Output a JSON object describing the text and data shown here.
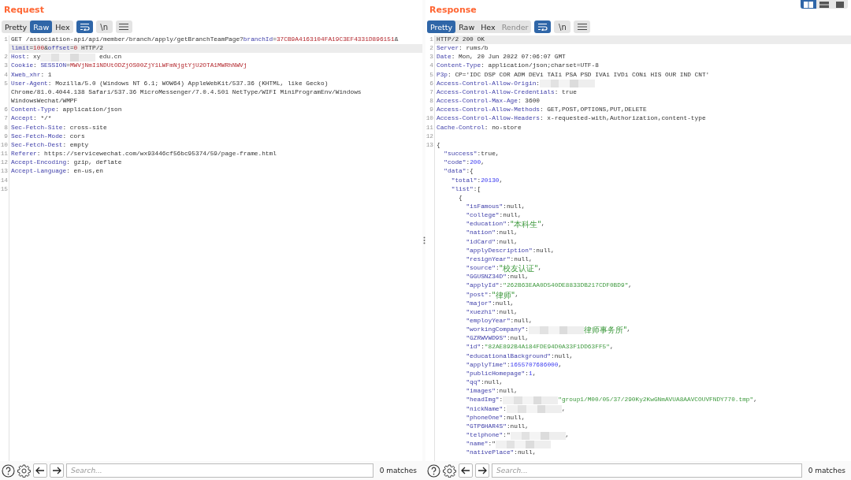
{
  "panes": [
    {
      "title": "Request",
      "tabs": [
        {
          "label": "Pretty",
          "selected": false,
          "disabled": false
        },
        {
          "label": "Raw",
          "selected": true,
          "disabled": false
        },
        {
          "label": "Hex",
          "selected": false,
          "disabled": false
        }
      ],
      "wrap_on": true,
      "newline_label": "\\n",
      "newline_on": false,
      "rows": [
        {
          "number": "1",
          "current": false,
          "segments": [
            {
              "kind": "plain",
              "text": "GET /association-api/api/member/branch/apply/getBranchTeamPage?"
            },
            {
              "kind": "key",
              "text": "branchId"
            },
            {
              "kind": "plain",
              "text": "="
            },
            {
              "kind": "param",
              "text": "37CB9A4163104FA19C3EF4331D896151"
            },
            {
              "kind": "plain",
              "text": "&"
            }
          ]
        },
        {
          "current": true,
          "segments": [
            {
              "kind": "key",
              "text": "limit"
            },
            {
              "kind": "plain",
              "text": "="
            },
            {
              "kind": "param",
              "text": "100"
            },
            {
              "kind": "plain",
              "text": "&"
            },
            {
              "kind": "key",
              "text": "offset"
            },
            {
              "kind": "plain",
              "text": "="
            },
            {
              "kind": "param",
              "text": "0"
            },
            {
              "kind": "plain",
              "text": " HTTP/2"
            }
          ]
        },
        {
          "number": "2",
          "current": false,
          "segments": [
            {
              "kind": "key",
              "text": "Host"
            },
            {
              "kind": "plain",
              "text": ": xy"
            },
            {
              "kind": "redacted"
            },
            {
              "kind": "plain",
              "text": " edu.cn"
            }
          ]
        },
        {
          "number": "3",
          "current": false,
          "segments": [
            {
              "kind": "key",
              "text": "Cookie"
            },
            {
              "kind": "plain",
              "text": ": "
            },
            {
              "kind": "key",
              "text": "SESSION"
            },
            {
              "kind": "plain",
              "text": "="
            },
            {
              "kind": "param",
              "text": "MWVjNmI1NDUtODZjOS00ZjY1LWFmNjgtYjU2OTA1MWRhNWVj"
            }
          ]
        },
        {
          "number": "4",
          "current": false,
          "segments": [
            {
              "kind": "key",
              "text": "Xweb_xhr"
            },
            {
              "kind": "plain",
              "text": ": 1"
            }
          ]
        },
        {
          "number": "5",
          "current": false,
          "segments": [
            {
              "kind": "key",
              "text": "User-Agent"
            },
            {
              "kind": "plain",
              "text": ": Mozilla/5.0 (Windows NT 6.1; WOW64) AppleWebKit/537.36 (KHTML, like Gecko)"
            }
          ]
        },
        {
          "current": false,
          "segments": [
            {
              "kind": "plain",
              "text": "Chrome/81.0.4044.138 Safari/537.36 MicroMessenger/7.0.4.501 NetType/WIFI MiniProgramEnv/Windows"
            }
          ]
        },
        {
          "current": false,
          "segments": [
            {
              "kind": "plain",
              "text": "WindowsWechat/WMPF"
            }
          ]
        },
        {
          "number": "6",
          "current": false,
          "segments": [
            {
              "kind": "key",
              "text": "Content-Type"
            },
            {
              "kind": "plain",
              "text": ": application/json"
            }
          ]
        },
        {
          "number": "7",
          "current": false,
          "segments": [
            {
              "kind": "key",
              "text": "Accept"
            },
            {
              "kind": "plain",
              "text": ": */*"
            }
          ]
        },
        {
          "number": "8",
          "current": false,
          "segments": [
            {
              "kind": "key",
              "text": "Sec-Fetch-Site"
            },
            {
              "kind": "plain",
              "text": ": cross-site"
            }
          ]
        },
        {
          "number": "9",
          "current": false,
          "segments": [
            {
              "kind": "key",
              "text": "Sec-Fetch-Mode"
            },
            {
              "kind": "plain",
              "text": ": cors"
            }
          ]
        },
        {
          "number": "10",
          "current": false,
          "segments": [
            {
              "kind": "key",
              "text": "Sec-Fetch-Dest"
            },
            {
              "kind": "plain",
              "text": ": empty"
            }
          ]
        },
        {
          "number": "11",
          "current": false,
          "segments": [
            {
              "kind": "key",
              "text": "Referer"
            },
            {
              "kind": "plain",
              "text": ": https://servicewechat.com/wx93446cf56bc95374/59/page-frame.html"
            }
          ]
        },
        {
          "number": "12",
          "current": false,
          "segments": [
            {
              "kind": "key",
              "text": "Accept-Encoding"
            },
            {
              "kind": "plain",
              "text": ": gzip, deflate"
            }
          ]
        },
        {
          "number": "13",
          "current": false,
          "segments": [
            {
              "kind": "key",
              "text": "Accept-Language"
            },
            {
              "kind": "plain",
              "text": ": en-us,en"
            }
          ]
        },
        {
          "number": "14",
          "current": false
        },
        {
          "number": "15",
          "current": false
        }
      ],
      "search": {
        "placeholder": "Search...",
        "matches": "0 matches"
      }
    },
    {
      "title": "Response",
      "tabs": [
        {
          "label": "Pretty",
          "selected": true,
          "disabled": false
        },
        {
          "label": "Raw",
          "selected": false,
          "disabled": false
        },
        {
          "label": "Hex",
          "selected": false,
          "disabled": false
        },
        {
          "label": "Render",
          "selected": false,
          "disabled": true
        }
      ],
      "wrap_on": true,
      "newline_label": "\\n",
      "newline_on": false,
      "layout_switch": true,
      "rows": [
        {
          "number": "1",
          "current": true,
          "segments": [
            {
              "kind": "plain",
              "text": "HTTP/2 200 OK"
            }
          ]
        },
        {
          "number": "2",
          "current": false,
          "segments": [
            {
              "kind": "key",
              "text": "Server"
            },
            {
              "kind": "plain",
              "text": ": rums/b"
            }
          ]
        },
        {
          "number": "3",
          "current": false,
          "segments": [
            {
              "kind": "key",
              "text": "Date"
            },
            {
              "kind": "plain",
              "text": ": Mon, 20 Jun 2022 07:06:07 GMT"
            }
          ]
        },
        {
          "number": "4",
          "current": false,
          "segments": [
            {
              "kind": "key",
              "text": "Content-Type"
            },
            {
              "kind": "plain",
              "text": ": application/json;charset=UTF-8"
            }
          ]
        },
        {
          "number": "5",
          "current": false,
          "segments": [
            {
              "kind": "key",
              "text": "P3p"
            },
            {
              "kind": "plain",
              "text": ": CP='IDC DSP COR ADM DEVi TAIi PSA PSD IVAi IVDi CONi HIS OUR IND CNT'"
            }
          ]
        },
        {
          "number": "6",
          "current": false,
          "segments": [
            {
              "kind": "key",
              "text": "Access-Control-Allow-Origin"
            },
            {
              "kind": "plain",
              "text": ":"
            },
            {
              "kind": "redacted"
            }
          ]
        },
        {
          "number": "7",
          "current": false,
          "segments": [
            {
              "kind": "key",
              "text": "Access-Control-Allow-Credentials"
            },
            {
              "kind": "plain",
              "text": ": true"
            }
          ]
        },
        {
          "number": "8",
          "current": false,
          "segments": [
            {
              "kind": "key",
              "text": "Access-Control-Max-Age"
            },
            {
              "kind": "plain",
              "text": ": 3600"
            }
          ]
        },
        {
          "number": "9",
          "current": false,
          "segments": [
            {
              "kind": "key",
              "text": "Access-Control-Allow-Methods"
            },
            {
              "kind": "plain",
              "text": ": GET,POST,OPTIONS,PUT,DELETE"
            }
          ]
        },
        {
          "number": "10",
          "current": false,
          "segments": [
            {
              "kind": "key",
              "text": "Access-Control-Allow-Headers"
            },
            {
              "kind": "plain",
              "text": ": x-requested-with,Authorization,content-type"
            }
          ]
        },
        {
          "number": "11",
          "current": false,
          "segments": [
            {
              "kind": "key",
              "text": "Cache-Control"
            },
            {
              "kind": "plain",
              "text": ": no-store"
            }
          ]
        },
        {
          "number": "12",
          "current": false
        },
        {
          "number": "13",
          "current": false,
          "segments": [
            {
              "kind": "plain",
              "text": "{"
            }
          ]
        },
        {
          "current": false,
          "segments": [
            {
              "kind": "key",
              "text": "  \"success\""
            },
            {
              "kind": "plain",
              "text": ":true,"
            }
          ]
        },
        {
          "current": false,
          "segments": [
            {
              "kind": "key",
              "text": "  \"code\""
            },
            {
              "kind": "plain",
              "text": ":"
            },
            {
              "kind": "num",
              "text": "200"
            },
            {
              "kind": "plain",
              "text": ","
            }
          ]
        },
        {
          "current": false,
          "segments": [
            {
              "kind": "key",
              "text": "  \"data\""
            },
            {
              "kind": "plain",
              "text": ":{"
            }
          ]
        },
        {
          "current": false,
          "segments": [
            {
              "kind": "key",
              "text": "    \"total\""
            },
            {
              "kind": "plain",
              "text": ":"
            },
            {
              "kind": "num",
              "text": "20130"
            },
            {
              "kind": "plain",
              "text": ","
            }
          ]
        },
        {
          "current": false,
          "segments": [
            {
              "kind": "key",
              "text": "    \"list\""
            },
            {
              "kind": "plain",
              "text": ":["
            }
          ]
        },
        {
          "current": false,
          "segments": [
            {
              "kind": "plain",
              "text": "      {"
            }
          ]
        },
        {
          "current": false,
          "segments": [
            {
              "kind": "key",
              "text": "        \"isFamous\""
            },
            {
              "kind": "plain",
              "text": ":null,"
            }
          ]
        },
        {
          "current": false,
          "segments": [
            {
              "kind": "key",
              "text": "        \"college\""
            },
            {
              "kind": "plain",
              "text": ":null,"
            }
          ]
        },
        {
          "current": false,
          "segments": [
            {
              "kind": "key",
              "text": "        \"education\""
            },
            {
              "kind": "plain",
              "text": ":"
            },
            {
              "kind": "str_cjk",
              "text": "\"本科生\""
            },
            {
              "kind": "plain",
              "text": ","
            }
          ]
        },
        {
          "current": false,
          "segments": [
            {
              "kind": "key",
              "text": "        \"nation\""
            },
            {
              "kind": "plain",
              "text": ":null,"
            }
          ]
        },
        {
          "current": false,
          "segments": [
            {
              "kind": "key",
              "text": "        \"idCard\""
            },
            {
              "kind": "plain",
              "text": ":null,"
            }
          ]
        },
        {
          "current": false,
          "segments": [
            {
              "kind": "key",
              "text": "        \"applyDescription\""
            },
            {
              "kind": "plain",
              "text": ":null,"
            }
          ]
        },
        {
          "current": false,
          "segments": [
            {
              "kind": "key",
              "text": "        \"resignYear\""
            },
            {
              "kind": "plain",
              "text": ":null,"
            }
          ]
        },
        {
          "current": false,
          "segments": [
            {
              "kind": "key",
              "text": "        \"source\""
            },
            {
              "kind": "plain",
              "text": ":"
            },
            {
              "kind": "str_cjk",
              "text": "\"校友认证\""
            },
            {
              "kind": "plain",
              "text": ","
            }
          ]
        },
        {
          "current": false,
          "segments": [
            {
              "kind": "key",
              "text": "        \"GGUSNZ34D\""
            },
            {
              "kind": "plain",
              "text": ":null,"
            }
          ]
        },
        {
          "current": false,
          "segments": [
            {
              "kind": "key",
              "text": "        \"applyId\""
            },
            {
              "kind": "plain",
              "text": ":"
            },
            {
              "kind": "str",
              "text": "\"262B63EAA0D540DE8833DB217CDF0BD9\""
            },
            {
              "kind": "plain",
              "text": ","
            }
          ]
        },
        {
          "current": false,
          "segments": [
            {
              "kind": "key",
              "text": "        \"post\""
            },
            {
              "kind": "plain",
              "text": ":"
            },
            {
              "kind": "str_cjk",
              "text": "\"律师\""
            },
            {
              "kind": "plain",
              "text": ","
            }
          ]
        },
        {
          "current": false,
          "segments": [
            {
              "kind": "key",
              "text": "        \"major\""
            },
            {
              "kind": "plain",
              "text": ":null,"
            }
          ]
        },
        {
          "current": false,
          "segments": [
            {
              "kind": "key",
              "text": "        \"xuezhi\""
            },
            {
              "kind": "plain",
              "text": ":null,"
            }
          ]
        },
        {
          "current": false,
          "segments": [
            {
              "kind": "key",
              "text": "        \"employYear\""
            },
            {
              "kind": "plain",
              "text": ":null,"
            }
          ]
        },
        {
          "current": false,
          "segments": [
            {
              "kind": "key",
              "text": "        \"workingCompany\""
            },
            {
              "kind": "plain",
              "text": ":"
            },
            {
              "kind": "redacted"
            },
            {
              "kind": "str_cjk",
              "text": "律师事务所\""
            },
            {
              "kind": "plain",
              "text": ","
            }
          ]
        },
        {
          "current": false,
          "segments": [
            {
              "kind": "key",
              "text": "        \"GZRWVWD9S\""
            },
            {
              "kind": "plain",
              "text": ":null,"
            }
          ]
        },
        {
          "current": false,
          "segments": [
            {
              "kind": "key",
              "text": "        \"id\""
            },
            {
              "kind": "plain",
              "text": ":"
            },
            {
              "kind": "str",
              "text": "\"82AE892B4A184FDE94D0A33F1DD63FF5\""
            },
            {
              "kind": "plain",
              "text": ","
            }
          ]
        },
        {
          "current": false,
          "segments": [
            {
              "kind": "key",
              "text": "        \"educationalBackground\""
            },
            {
              "kind": "plain",
              "text": ":null,"
            }
          ]
        },
        {
          "current": false,
          "segments": [
            {
              "kind": "key",
              "text": "        \"applyTime\""
            },
            {
              "kind": "plain",
              "text": ":"
            },
            {
              "kind": "num",
              "text": "1655707686000"
            },
            {
              "kind": "plain",
              "text": ","
            }
          ]
        },
        {
          "current": false,
          "segments": [
            {
              "kind": "key",
              "text": "        \"publicHomepage\""
            },
            {
              "kind": "plain",
              "text": ":"
            },
            {
              "kind": "num",
              "text": "1"
            },
            {
              "kind": "plain",
              "text": ","
            }
          ]
        },
        {
          "current": false,
          "segments": [
            {
              "kind": "key",
              "text": "        \"qq\""
            },
            {
              "kind": "plain",
              "text": ":null,"
            }
          ]
        },
        {
          "current": false,
          "segments": [
            {
              "kind": "key",
              "text": "        \"images\""
            },
            {
              "kind": "plain",
              "text": ":null,"
            }
          ]
        },
        {
          "current": false,
          "segments": [
            {
              "kind": "key",
              "text": "        \"headImg\""
            },
            {
              "kind": "plain",
              "text": ":"
            },
            {
              "kind": "redacted"
            },
            {
              "kind": "str",
              "text": "\"group1/M00/05/37/290Ky2KwGNmAVUA8AAVCOUVFNDY770.tmp\""
            },
            {
              "kind": "plain",
              "text": ","
            }
          ]
        },
        {
          "current": false,
          "segments": [
            {
              "kind": "key",
              "text": "        \"nickName\""
            },
            {
              "kind": "plain",
              "text": ":"
            },
            {
              "kind": "redacted"
            },
            {
              "kind": "plain",
              "text": ","
            }
          ]
        },
        {
          "current": false,
          "segments": [
            {
              "kind": "key",
              "text": "        \"phoneOne\""
            },
            {
              "kind": "plain",
              "text": ":null,"
            }
          ]
        },
        {
          "current": false,
          "segments": [
            {
              "kind": "key",
              "text": "        \"GTP6HAR4S\""
            },
            {
              "kind": "plain",
              "text": ":null,"
            }
          ]
        },
        {
          "current": false,
          "segments": [
            {
              "kind": "key",
              "text": "        \"telphone\""
            },
            {
              "kind": "plain",
              "text": ":\""
            },
            {
              "kind": "redacted"
            },
            {
              "kind": "plain",
              "text": ","
            }
          ]
        },
        {
          "current": false,
          "segments": [
            {
              "kind": "key",
              "text": "        \"name\""
            },
            {
              "kind": "plain",
              "text": ":\""
            },
            {
              "kind": "redacted"
            }
          ]
        },
        {
          "current": false,
          "segments": [
            {
              "kind": "key",
              "text": "        \"nativePlace\""
            },
            {
              "kind": "plain",
              "text": ":null,"
            }
          ]
        }
      ],
      "search": {
        "placeholder": "Search...",
        "matches": "0 matches"
      }
    }
  ]
}
